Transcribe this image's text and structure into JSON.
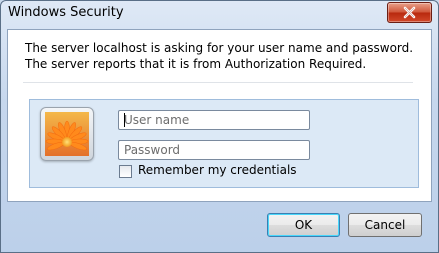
{
  "window": {
    "title": "Windows Security"
  },
  "close_button": {
    "icon": "close-icon",
    "color": "#c42b1c"
  },
  "message": "The server localhost is asking for your user name and password. The server reports that it is from Authorization Required.",
  "credentials": {
    "avatar_icon": "user-tile-flower-icon",
    "username_placeholder": "User name",
    "username_value": "",
    "password_placeholder": "Password",
    "password_value": "",
    "remember_label": "Remember my credentials",
    "remember_checked": false
  },
  "buttons": {
    "ok": "OK",
    "cancel": "Cancel"
  }
}
